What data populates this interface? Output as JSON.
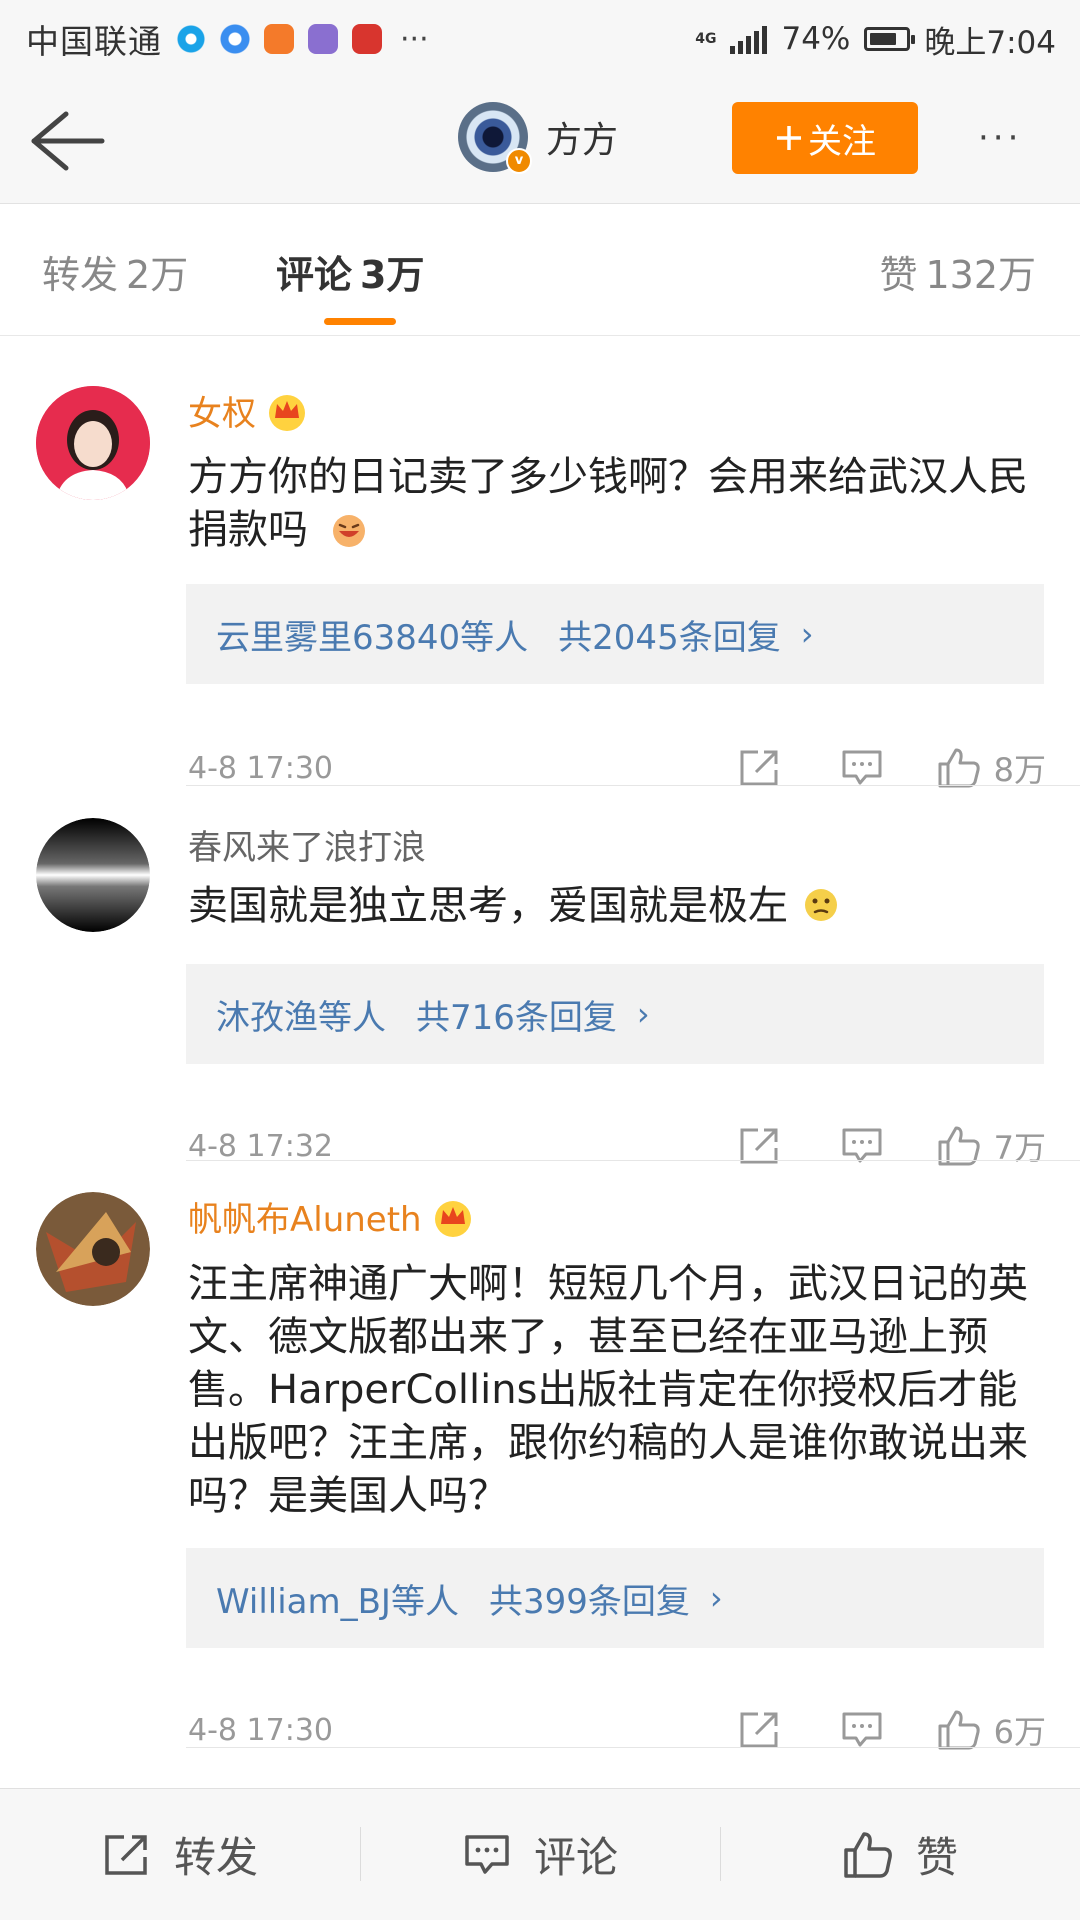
{
  "status_bar": {
    "carrier": "中国联通",
    "network": "4G",
    "battery_percent": "74%",
    "battery_level": 0.74,
    "time": "晚上7:04",
    "app_icons": [
      "weibo-video-icon",
      "browser-icon",
      "uc-icon",
      "music-icon",
      "zhiwang-icon"
    ],
    "more_label": "···"
  },
  "header": {
    "name": "方方",
    "follow_label": "关注",
    "more_label": "···"
  },
  "tabs": {
    "repost": {
      "label": "转发",
      "count": "2万"
    },
    "comments": {
      "label": "评论",
      "count": "3万"
    },
    "likes": {
      "label": "赞",
      "count": "132万"
    }
  },
  "comments": [
    {
      "user": "女权",
      "text": "方方你的日记卖了多少钱啊？会用来给武汉人民捐款吗",
      "reply_users": "云里雾里63840等人",
      "reply_count": "共2045条回复",
      "time": "4-8 17:30",
      "likes": "8万"
    },
    {
      "user": "春风来了浪打浪",
      "text": "卖国就是独立思考，爱国就是极左",
      "reply_users": "沐孜渔等人",
      "reply_count": "共716条回复",
      "time": "4-8 17:32",
      "likes": "7万"
    },
    {
      "user": "帆帆布Aluneth",
      "text": "汪主席神通广大啊！短短几个月，武汉日记的英文、德文版都出来了，甚至已经在亚马逊上预售。HarperCollins出版社肯定在你授权后才能出版吧？汪主席，跟你约稿的人是谁你敢说出来吗？是美国人吗？",
      "reply_users": "William_BJ等人",
      "reply_count": "共399条回复",
      "time": "4-8 17:30",
      "likes": "6万"
    }
  ],
  "bottom_bar": {
    "repost": "转发",
    "comment": "评论",
    "like": "赞"
  },
  "colors": {
    "accent": "#ff8200",
    "vip_name": "#e8821e",
    "link": "#4a7ab0"
  }
}
